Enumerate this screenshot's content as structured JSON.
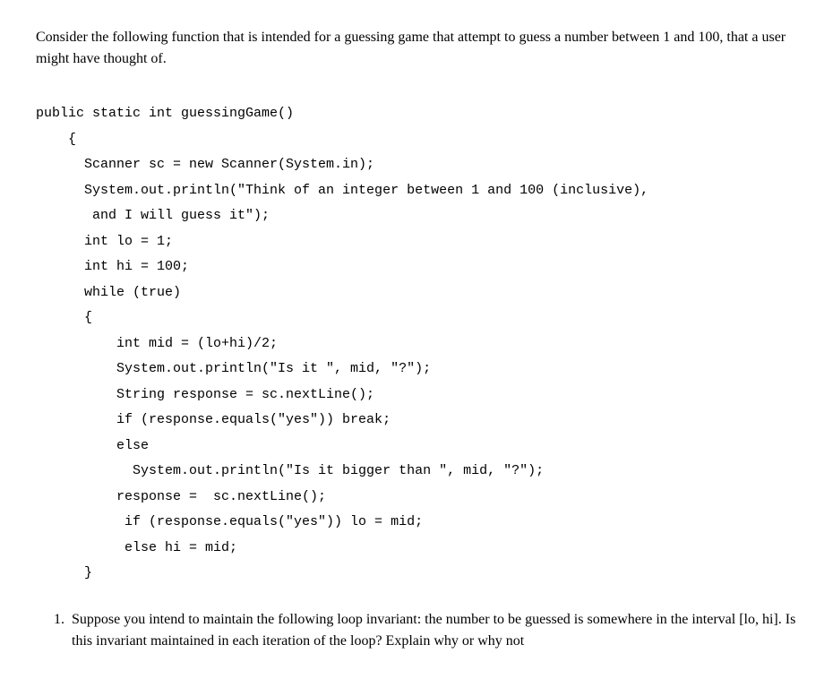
{
  "intro": "Consider the following function that is intended for a guessing game that attempt to guess a number between 1 and 100, that a user might have thought of.",
  "code": "public static int guessingGame()\n    {\n      Scanner sc = new Scanner(System.in);\n      System.out.println(\"Think of an integer between 1 and 100 (inclusive),\n       and I will guess it\");\n      int lo = 1;\n      int hi = 100;\n      while (true)\n      {\n          int mid = (lo+hi)/2;\n          System.out.println(\"Is it \", mid, \"?\");\n          String response = sc.nextLine();\n          if (response.equals(\"yes\")) break;\n          else\n            System.out.println(\"Is it bigger than \", mid, \"?\");\n          response =  sc.nextLine();\n           if (response.equals(\"yes\")) lo = mid;\n           else hi = mid;\n      }",
  "question": {
    "number": "1.",
    "text": "Suppose you intend to maintain the following loop invariant: the number to be guessed is somewhere in the interval [lo, hi]. Is this invariant maintained in each iteration of the loop? Explain why or why not"
  }
}
